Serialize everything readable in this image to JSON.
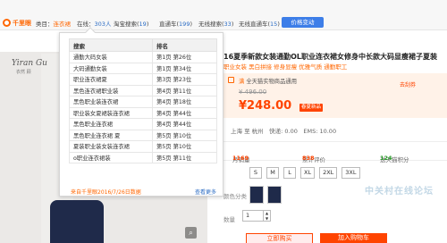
{
  "plugin_bar": {
    "logo_text": "千里眼",
    "stats": [
      {
        "label": "类目：",
        "value": "连衣裙",
        "style": "hl"
      },
      {
        "label": "在线：",
        "value": "303人",
        "style": "bl"
      },
      {
        "label": "淘宝搜索(",
        "value": "19",
        "suffix": ")",
        "style": "bl"
      },
      {
        "label": "直通车(",
        "value": "199",
        "suffix": ")",
        "style": "bl"
      },
      {
        "label": "无线搜索(",
        "value": "33",
        "suffix": ")",
        "style": "bl"
      },
      {
        "label": "无线直通车(",
        "value": "15",
        "suffix": ")",
        "style": "bl"
      }
    ],
    "price_change_button": "价格变动"
  },
  "search_popup": {
    "columns": [
      "搜索",
      "排名"
    ],
    "rows": [
      {
        "keyword": "通勤大码女装",
        "rank": "第1页 第26位"
      },
      {
        "keyword": "大码通勤女装",
        "rank": "第1页 第34位"
      },
      {
        "keyword": "职业连衣裙夏",
        "rank": "第3页 第23位"
      },
      {
        "keyword": "黑色连衣裙职业装",
        "rank": "第4页 第11位"
      },
      {
        "keyword": "黑色职业装连衣裙",
        "rank": "第4页 第18位"
      },
      {
        "keyword": "职业装女夏裙装连衣裙",
        "rank": "第4页 第44位"
      },
      {
        "keyword": "黑色职业连衣裙",
        "rank": "第4页 第44位"
      },
      {
        "keyword": "黑色职业连衣裙 夏",
        "rank": "第5页 第10位"
      },
      {
        "keyword": "夏装职业装女装连衣裙",
        "rank": "第5页 第10位"
      },
      {
        "keyword": "o职业连衣裙装",
        "rank": "第5页 第11位"
      }
    ],
    "footnote": "来自千里眼2016/7/26日数据",
    "more_link": "查看更多"
  },
  "product_image": {
    "brand": "Yiran Gu",
    "brand_sub": "衣然 顾",
    "zoom_icon": "magnifier-icon"
  },
  "product": {
    "title": "16夏季新款女装通勤OL职业连衣裙女修身中长款大码显瘦裙子夏装",
    "tags": "职业女装 黑白拼接 修身显瘦 优雅气质 通勤职工",
    "promo_prefix": "满",
    "promo_text": "全天猫实物商品通用",
    "promo_link": "去刮券",
    "original_price": "¥ 496.00",
    "price": "¥248.00",
    "price_badge": "春夏新品",
    "ship_from": "上海 至 杭州",
    "ship_fee": "快递: 0.00",
    "ship_fee_label": "EMS: 10.00",
    "monthly_sales_label": "月销量",
    "monthly_sales": "1169",
    "reviews_label": "累计评价",
    "reviews": "838",
    "tmall_points_label": "送天猫积分",
    "tmall_points": "124",
    "sizes": [
      "S",
      "M",
      "L",
      "XL",
      "2XL",
      "3XL"
    ],
    "color_label": "颜色分类",
    "quantity_label": "数量",
    "quantity": "1",
    "buy_button": "立即购买",
    "cart_button": "加入购物车"
  },
  "watermark": "中关村在线论坛",
  "colors": {
    "accent": "#ff6600",
    "price": "#ff4400",
    "link": "#2b6cc4",
    "button": "#3d7ee8"
  }
}
